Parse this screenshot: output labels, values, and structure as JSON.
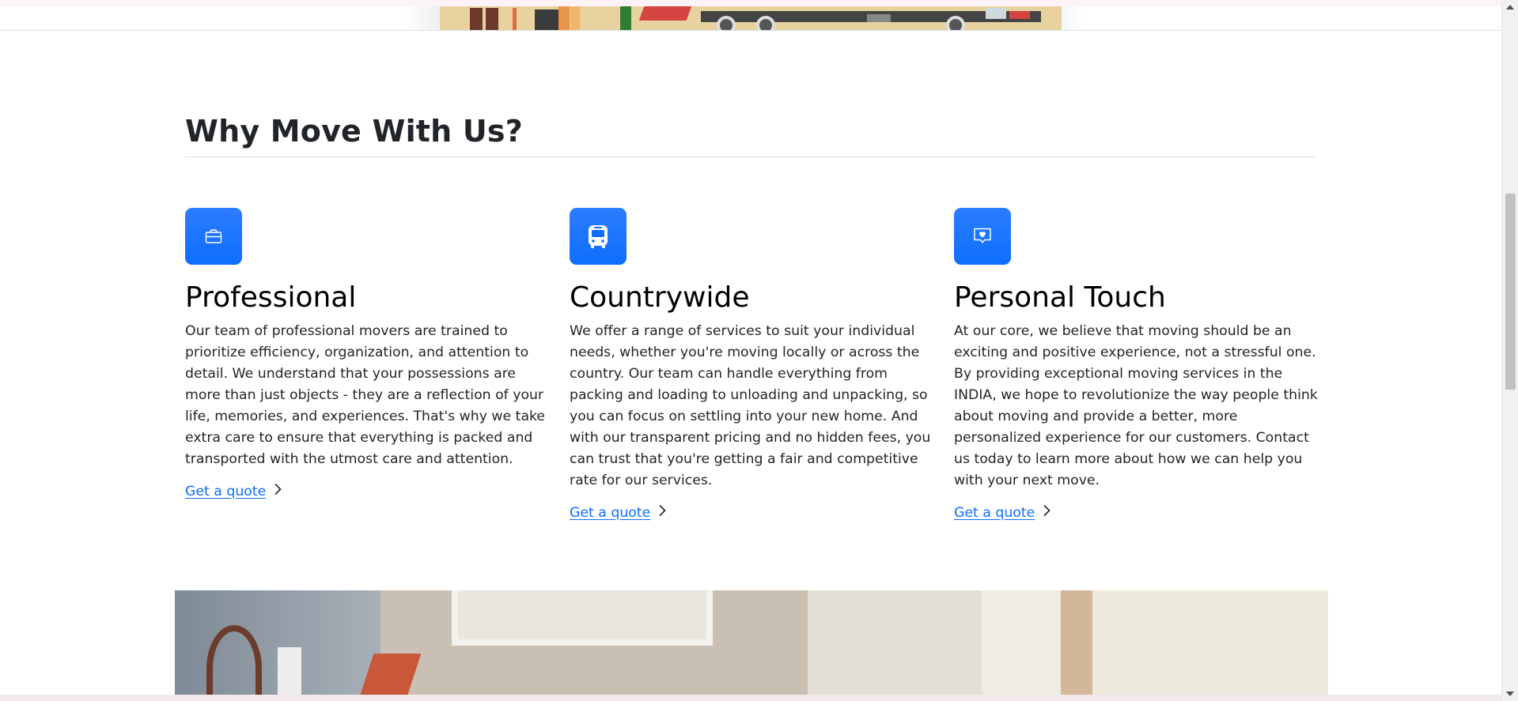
{
  "section": {
    "title": "Why Move With Us?"
  },
  "features": [
    {
      "icon": "briefcase-icon",
      "title": "Professional",
      "text": "Our team of professional movers are trained to prioritize efficiency, organization, and attention to detail. We understand that your possessions are more than just objects - they are a reflection of your life, memories, and experiences. That's why we take extra care to ensure that everything is packed and transported with the utmost care and attention.",
      "link": "Get a quote"
    },
    {
      "icon": "bus-icon",
      "title": "Countrywide",
      "text": "We offer a range of services to suit your individual needs, whether you're moving locally or across the country. Our team can handle everything from packing and loading to unloading and unpacking, so you can focus on settling into your new home. And with our transparent pricing and no hidden fees, you can trust that you're getting a fair and competitive rate for our services.",
      "link": "Get a quote"
    },
    {
      "icon": "chat-heart-icon",
      "title": "Personal Touch",
      "text": "At our core, we believe that moving should be an exciting and positive experience, not a stressful one. By providing exceptional moving services in the INDIA, we hope to revolutionize the way people think about moving and provide a better, more personalized experience for our customers. Contact us today to learn more about how we can help you with your next move.",
      "link": "Get a quote"
    }
  ],
  "colors": {
    "accent": "#0d6efd",
    "text": "#212529"
  }
}
